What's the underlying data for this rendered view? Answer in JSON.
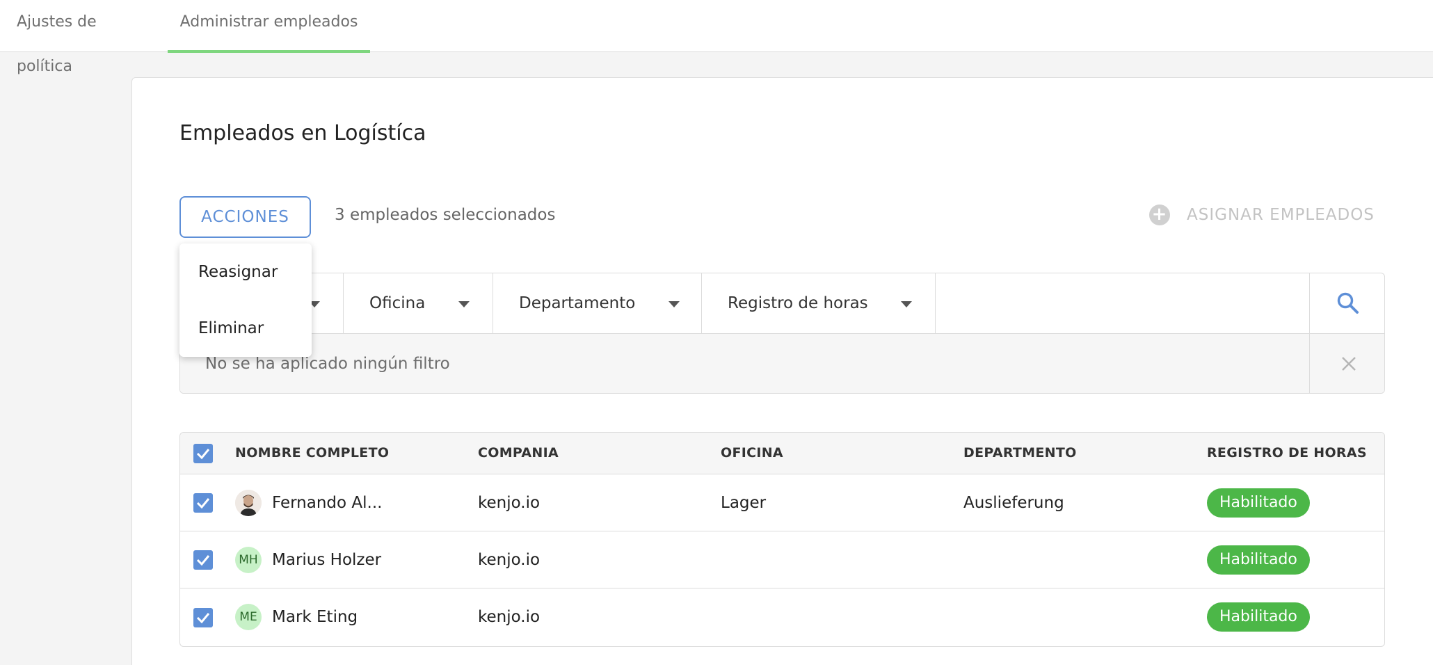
{
  "tabs": [
    {
      "label": "Ajustes de política",
      "active": false
    },
    {
      "label": "Administrar empleados",
      "active": true
    }
  ],
  "page": {
    "title": "Empleados en Logístíca",
    "actions_label": "ACCIONES",
    "selected_text": "3 empleados seleccionados",
    "assign_label": "ASIGNAR EMPLEADOS"
  },
  "actions_menu": {
    "items": [
      "Reasignar",
      "Eliminar"
    ]
  },
  "filters": {
    "selects": [
      "",
      "Oficina",
      "Departamento",
      "Registro de horas"
    ],
    "search_value": "",
    "no_filter_text": "No se ha aplicado ningún filtro"
  },
  "table": {
    "headers": [
      "NOMBRE COMPLETO",
      "COMPANIA",
      "OFICINA",
      "DEPARTMENTO",
      "REGISTRO DE HORAS"
    ],
    "rows": [
      {
        "initials": "",
        "name": "Fernando Al...",
        "company": "kenjo.io",
        "office": "Lager",
        "department": "Auslieferung",
        "status": "Habilitado",
        "checked": true
      },
      {
        "initials": "MH",
        "name": "Marius Holzer",
        "company": "kenjo.io",
        "office": "",
        "department": "",
        "status": "Habilitado",
        "checked": true
      },
      {
        "initials": "ME",
        "name": "Mark Eting",
        "company": "kenjo.io",
        "office": "",
        "department": "",
        "status": "Habilitado",
        "checked": true
      }
    ]
  },
  "colors": {
    "accent_blue": "#5e8fd7",
    "active_tab_green": "#7ed67e",
    "status_green": "#4cb748"
  }
}
